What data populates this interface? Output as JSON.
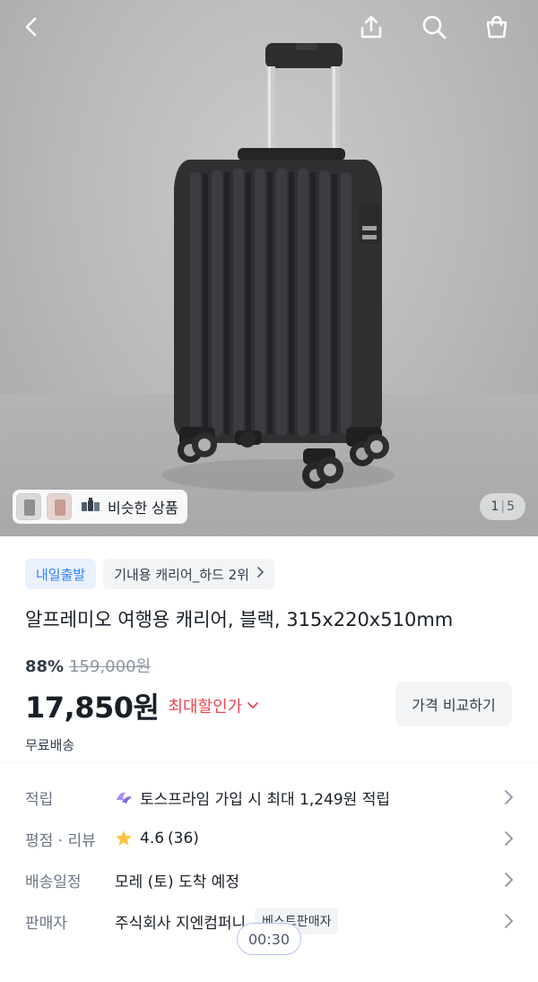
{
  "hero": {
    "pager_current": "1",
    "pager_sep": "|",
    "pager_total": "5",
    "similar_label": "비슷한 상품",
    "icons": [
      "back-icon",
      "share-icon",
      "search-icon",
      "cart-icon"
    ]
  },
  "product": {
    "badges": {
      "delivery": "내일출발",
      "rank": "기내용 캐리어_하드 2위"
    },
    "title": "알프레미오 여행용 캐리어, 블랙, 315x220x510mm",
    "discount_rate": "88%",
    "original_price": "159,000원",
    "price": "17,850원",
    "max_discount_label": "최대할인가",
    "compare_button": "가격 비교하기",
    "shipping": "무료배송"
  },
  "info": [
    {
      "key": "적립",
      "value": "토스프라임 가입 시 최대 1,249원 적립"
    },
    {
      "key": "평점 · 리뷰",
      "rating": "4.6",
      "count": "(36)"
    },
    {
      "key": "배송일정",
      "value": "모레 (토) 도착 예정"
    },
    {
      "key": "판매자",
      "value": "주식회사 지엔컴퍼니",
      "badge": "베스트판매자"
    }
  ],
  "timer": "00:30",
  "colors": {
    "accent_blue": "#3182f6",
    "discount_red": "#f04452",
    "star": "#ffc342"
  }
}
